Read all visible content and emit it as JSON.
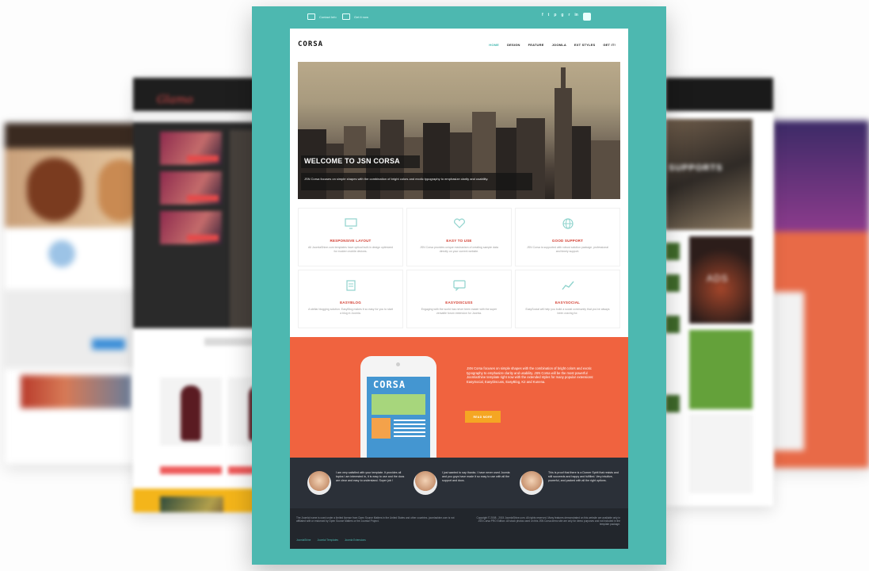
{
  "topbar": {
    "contact": "Contact Info",
    "cart": "Get it now"
  },
  "social_icons": [
    "f",
    "t",
    "p",
    "g",
    "r",
    "in"
  ],
  "brand": "CORSA",
  "menu": [
    "HOME",
    "DESIGN",
    "FEATURE",
    "JOOMLA",
    "EXT STYLES",
    "GET IT!"
  ],
  "hero": {
    "title": "WELCOME TO JSN CORSA",
    "description": "JSN Corsa focuses on simple shapes with the combination of bright colors and exotic typography to emphasize clarity and usability."
  },
  "features": [
    {
      "title": "RESPONSIVE LAYOUT",
      "icon": "monitor-icon",
      "desc": "All JoomlaShine.com templates have optical built-in design optimized for modern mobile devices."
    },
    {
      "title": "EASY TO USE",
      "icon": "heart-icon",
      "desc": "JSN Corsa provides unique mechanism of creating sample data directly on your current website."
    },
    {
      "title": "GOOD SUPPORT",
      "icon": "globe-icon",
      "desc": "JSN Corsa is supported with robust solution package, professional and timely support."
    },
    {
      "title": "EASYBLOG",
      "icon": "blog-icon",
      "desc": "A stellar blogging solution. EasyBlog makes it so easy for you to start a blog in Joomla."
    },
    {
      "title": "EASYDISCUSS",
      "icon": "chat-icon",
      "desc": "Engaging with the world has never been easier with the super versatile forum extension for Joomla."
    },
    {
      "title": "EASYSOCIAL",
      "icon": "chart-icon",
      "desc": "EasySocial will help you build a social community that you've always been craving for."
    }
  ],
  "promo": {
    "phone_title": "CORSA",
    "text": "JSN Corsa focuses on simple shapes with the combination of bright colors and exotic typography to emphasize clarity and usability. JSN Corsa will be the most powerful JoomlaShine template right now with the extended styles for many popular extensions: EasySocial, EasyDiscuss, EasyBlog, K2 and Kunena.",
    "button": "READ MORE"
  },
  "testimonials": [
    {
      "quote": "I am very satisfied with your template. It provides all topics I am interested in, it is easy to use and the docs are clear and easy to understand. Super job !"
    },
    {
      "quote": "I just wanted to say thanks. I have never used Joomla and you guys have made it so easy to use with all the support and docs."
    },
    {
      "quote": "This is proof that there is a Dorner Spirit that resists and still succeeds and happy and fulfilled. Very intuitive, powerful, and packed with all the right options."
    }
  ],
  "footer": {
    "left": "The Joomla! name is used under a limited license from Open Source Matters in the United States and other countries. joomlashine.com is not affiliated with or endorsed by Open Source Matters or the Joomla! Project.",
    "right": "Copyright © 2008 - 2015 JoomlaShine.com. All rights reserved. Many features demonstrated on this website are available only in JSN Corsa PRO Edition. All stock photos used on this JSN Corsa demo site are only for demo purposes and not included in the template package.",
    "links": [
      "JoomlaShine",
      "Joomla! Templates",
      "Joomla Extensions"
    ]
  },
  "bg": {
    "left_logo": "Glamo",
    "right_hero": "SUPPORTS",
    "right_ads": "ADS"
  }
}
